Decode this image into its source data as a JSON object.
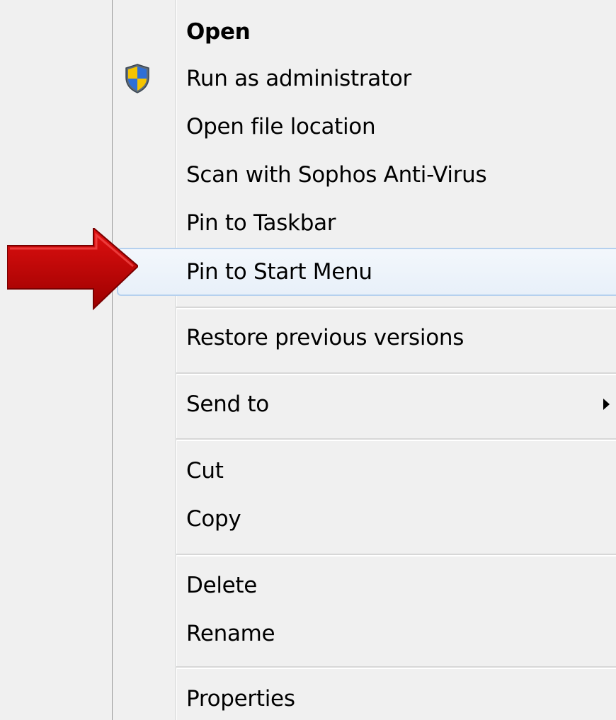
{
  "menu": {
    "items": [
      {
        "label": "Open",
        "bold": true
      },
      {
        "label": "Run as administrator",
        "icon": "uac-shield-icon"
      },
      {
        "label": "Open file location"
      },
      {
        "label": "Scan with Sophos Anti-Virus"
      },
      {
        "label": "Pin to Taskbar"
      },
      {
        "label": "Pin to Start Menu",
        "highlighted": true
      },
      {
        "label": "Restore previous versions"
      },
      {
        "label": "Send to",
        "submenu": true
      },
      {
        "label": "Cut"
      },
      {
        "label": "Copy"
      },
      {
        "label": "Delete"
      },
      {
        "label": "Rename"
      },
      {
        "label": "Properties"
      }
    ]
  },
  "annotation": {
    "icon": "red-pointer-arrow-icon",
    "color": "#c40000",
    "points_to": "Pin to Start Menu"
  },
  "colors": {
    "menu_background": "#f0f0f0",
    "highlight_border": "#b5d0ee",
    "highlight_fill": "#e8f0f9",
    "separator": "#d7d7d7"
  }
}
